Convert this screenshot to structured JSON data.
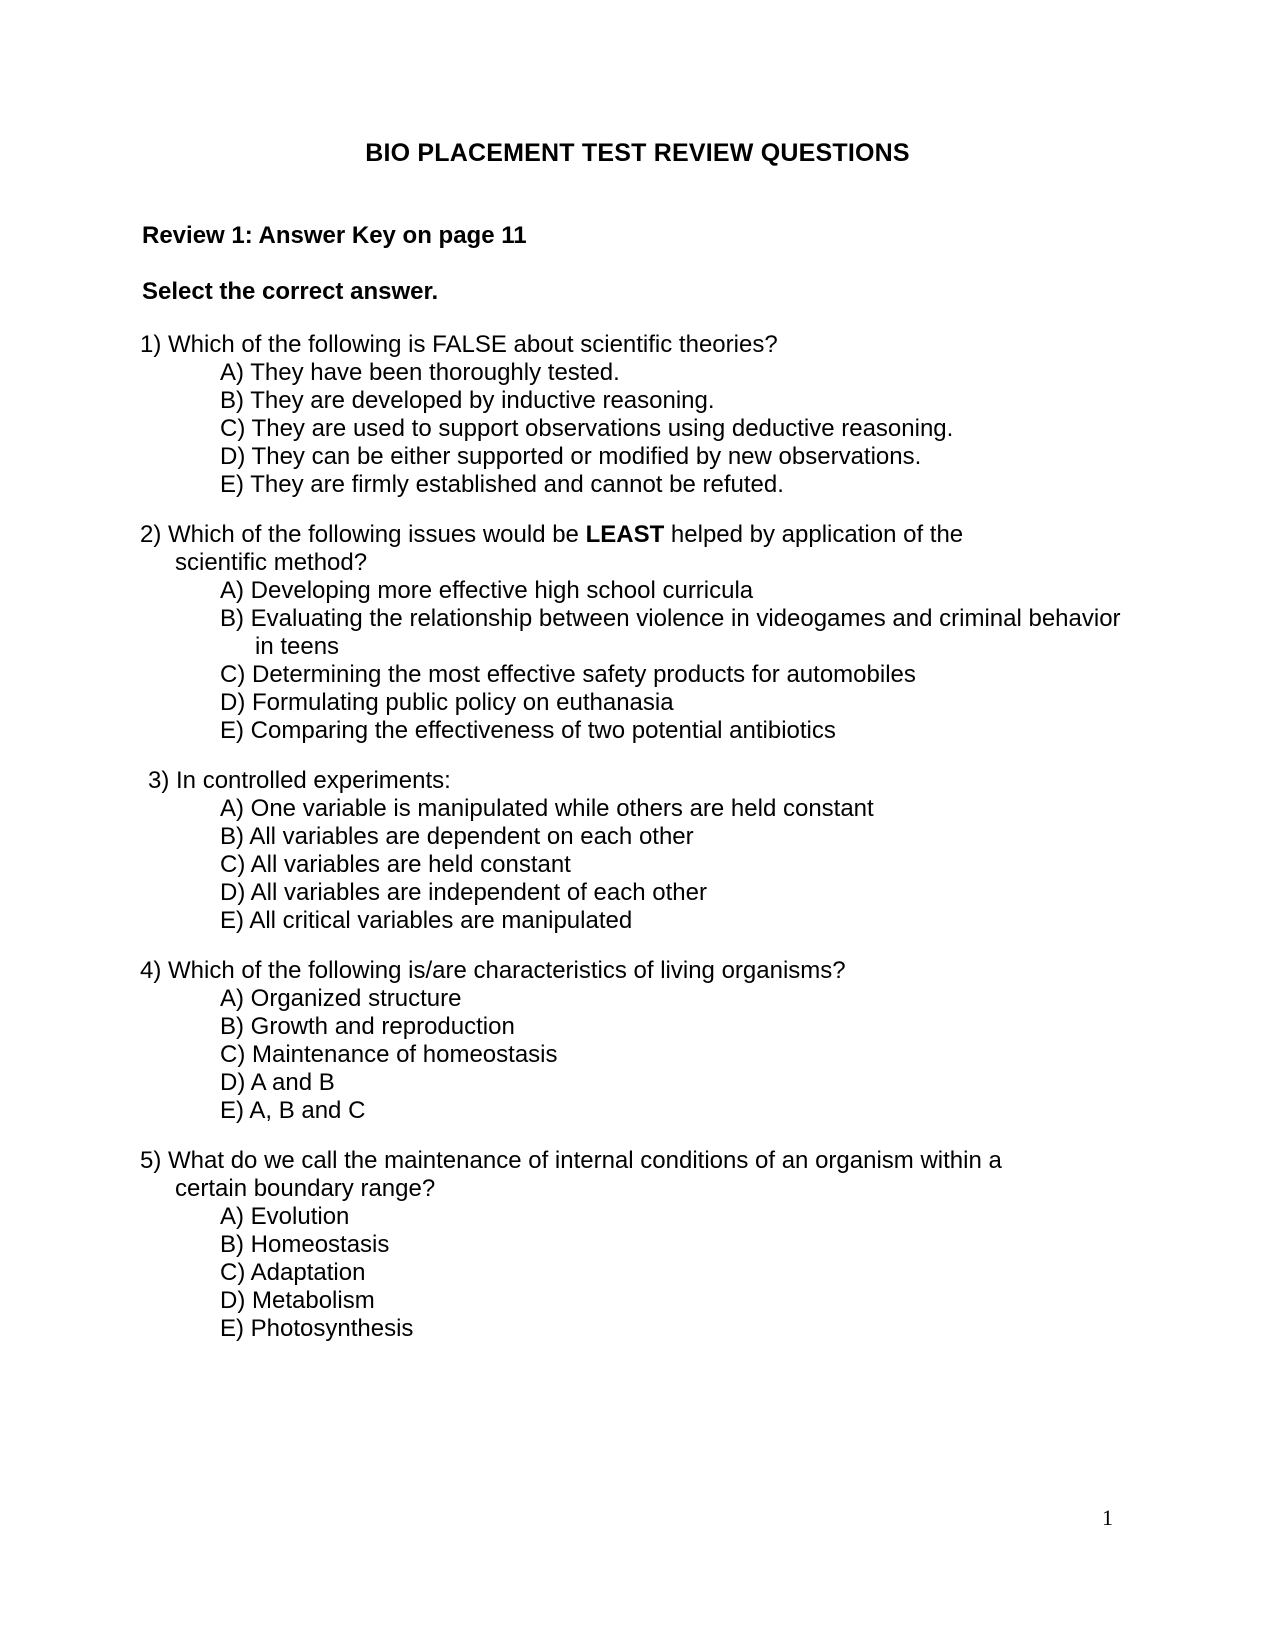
{
  "document": {
    "title": "BIO PLACEMENT TEST REVIEW QUESTIONS",
    "review_heading": "Review 1: Answer Key on page 11",
    "instruction": "Select the correct answer.",
    "page_number": "1"
  },
  "questions": [
    {
      "number": "1)",
      "stem": "Which of the following is FALSE about scientific theories?",
      "options": [
        "A) They have been thoroughly tested.",
        "B) They are developed by inductive reasoning.",
        "C) They are used to support observations using deductive reasoning.",
        "D) They can be either supported or modified by new observations.",
        "E) They are firmly established and cannot be refuted."
      ]
    },
    {
      "number": "2)",
      "stem_before_bold": "Which of the following issues would be ",
      "stem_bold": "LEAST",
      "stem_after_bold": " helped by application of the scientific method?",
      "options": [
        "A) Developing more effective high school curricula",
        "B) Evaluating the relationship between violence in videogames and criminal behavior in teens",
        "C) Determining the most effective safety products for automobiles",
        "D) Formulating public policy on euthanasia",
        "E) Comparing the effectiveness of two potential antibiotics"
      ]
    },
    {
      "number": "3)",
      "stem": "In controlled experiments:",
      "options": [
        "A) One variable is manipulated while others are held constant",
        "B) All variables are dependent on each other",
        "C) All variables are held constant",
        "D) All variables are independent of each other",
        "E) All critical variables are manipulated"
      ]
    },
    {
      "number": "4)",
      "stem": "Which of the following is/are characteristics of living organisms?",
      "options": [
        "A) Organized structure",
        "B) Growth and reproduction",
        "C) Maintenance of homeostasis",
        "D) A and B",
        "E) A, B and C"
      ]
    },
    {
      "number": "5)",
      "stem": "What do we call the maintenance of internal conditions of an organism within a certain boundary range?",
      "options": [
        "A) Evolution",
        "B) Homeostasis",
        "C) Adaptation",
        "D) Metabolism",
        "E) Photosynthesis"
      ]
    }
  ]
}
